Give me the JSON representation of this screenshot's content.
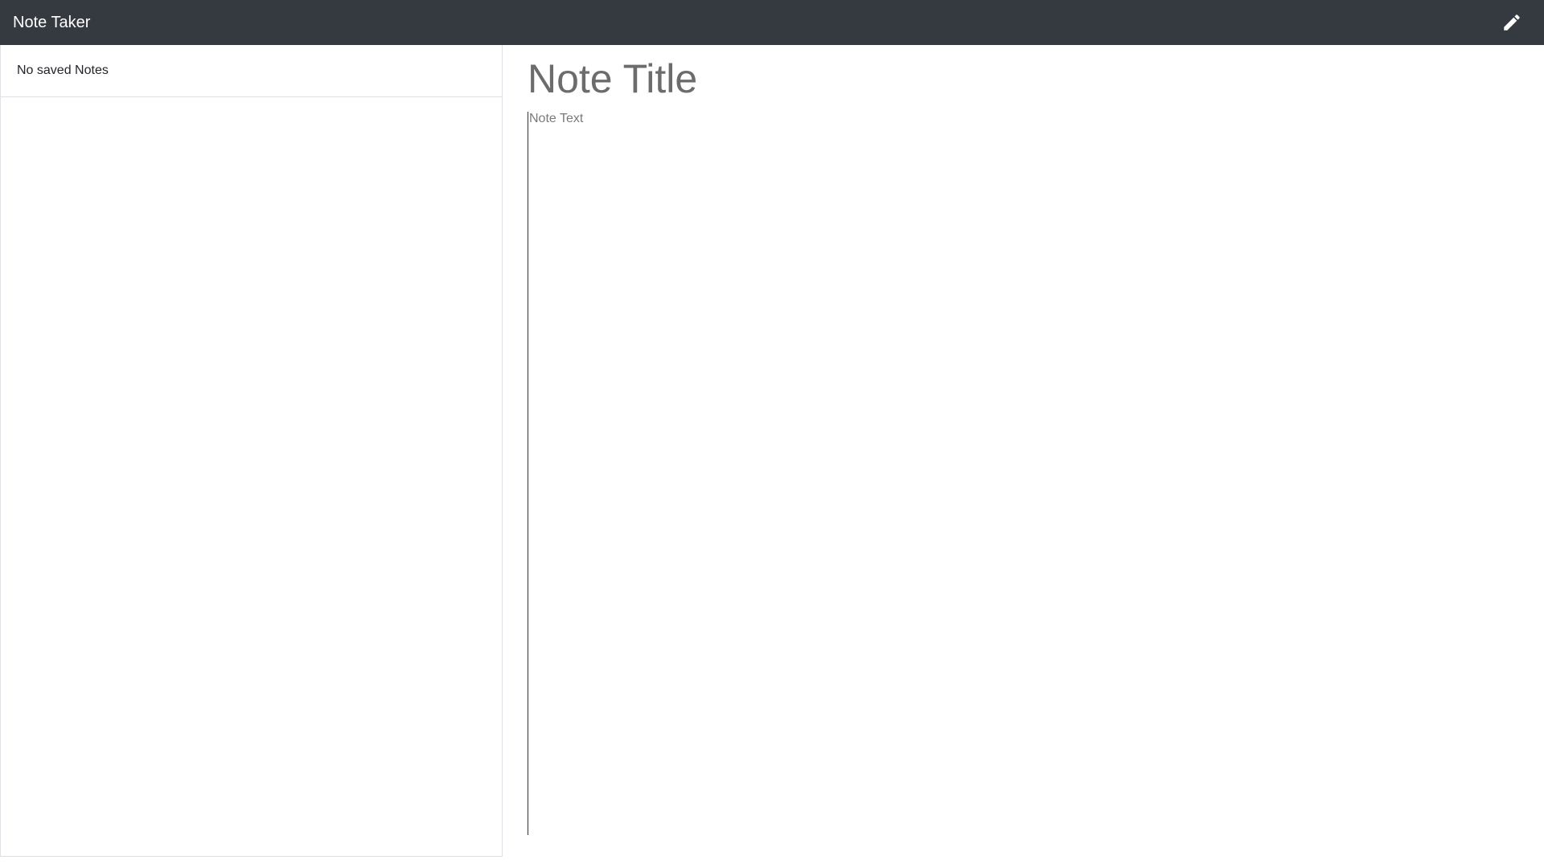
{
  "navbar": {
    "brand": "Note Taker",
    "new_note_icon": "pencil-icon"
  },
  "sidebar": {
    "empty_message": "No saved Notes"
  },
  "editor": {
    "title_placeholder": "Note Title",
    "title_value": "",
    "text_placeholder": "Note Text",
    "text_value": ""
  },
  "colors": {
    "navbar_bg": "#343a40",
    "border": "#dee2e6"
  }
}
